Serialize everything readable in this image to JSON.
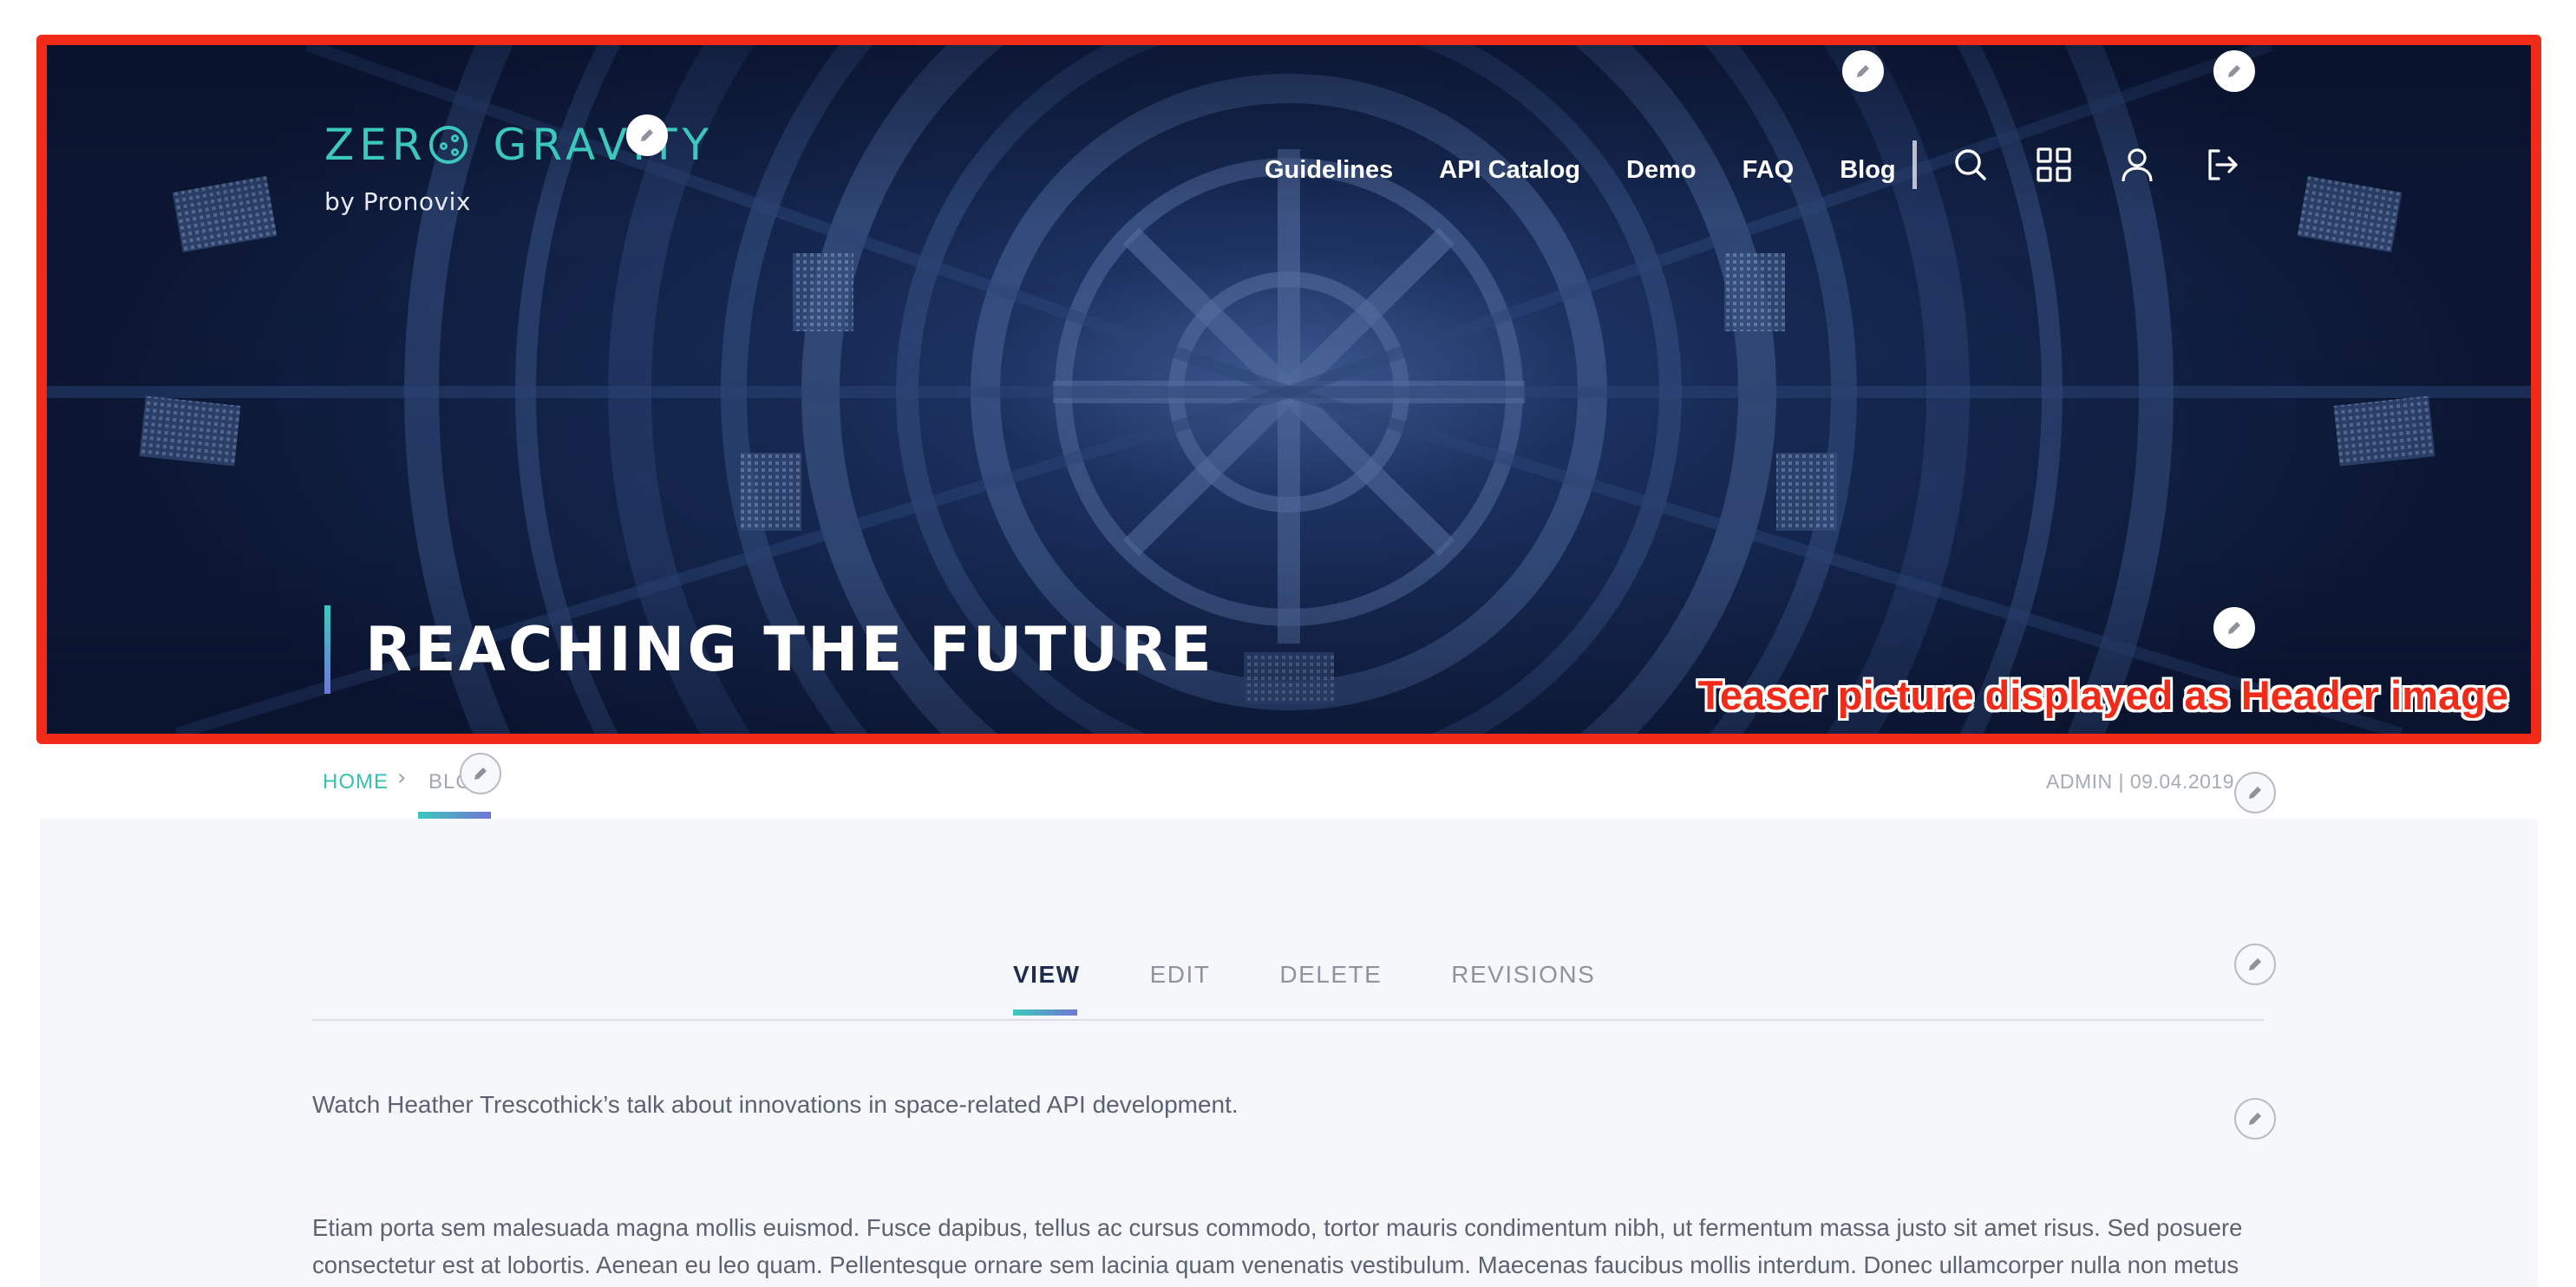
{
  "header": {
    "logo_main_left": "ZER",
    "logo_main_right": "GRAVITY",
    "logo_sub": "by Pronovix",
    "nav": [
      {
        "label": "Guidelines"
      },
      {
        "label": "API Catalog"
      },
      {
        "label": "Demo"
      },
      {
        "label": "FAQ"
      },
      {
        "label": "Blog"
      }
    ],
    "icons": [
      "search-icon",
      "apps-grid-icon",
      "user-icon",
      "logout-icon"
    ],
    "page_title": "REACHING THE FUTURE"
  },
  "annotation": {
    "text": "Teaser picture displayed as Header image",
    "color": "#f22b18"
  },
  "breadcrumb": {
    "home": "HOME",
    "current": "BLOG"
  },
  "meta": {
    "text": "ADMIN | 09.04.2019"
  },
  "tabs": [
    {
      "label": "VIEW",
      "active": true
    },
    {
      "label": "EDIT",
      "active": false
    },
    {
      "label": "DELETE",
      "active": false
    },
    {
      "label": "REVISIONS",
      "active": false
    }
  ],
  "content": {
    "intro": "Watch Heather Trescothick’s talk about innovations in space-related API development.",
    "body": "Etiam porta sem malesuada magna mollis euismod. Fusce dapibus, tellus ac cursus commodo, tortor mauris condimentum nibh, ut fermentum massa justo sit amet risus. Sed posuere consectetur est at lobortis. Aenean eu leo quam. Pellentesque ornare sem lacinia quam venenatis vestibulum. Maecenas faucibus mollis interdum. Donec ullamcorper nulla non metus"
  },
  "colors": {
    "accent_teal": "#3cc9bd",
    "accent_violet": "#6f76d6",
    "hero_navy": "#15274f",
    "text_dark": "#1e2d4c",
    "text_body": "#5b6272"
  }
}
